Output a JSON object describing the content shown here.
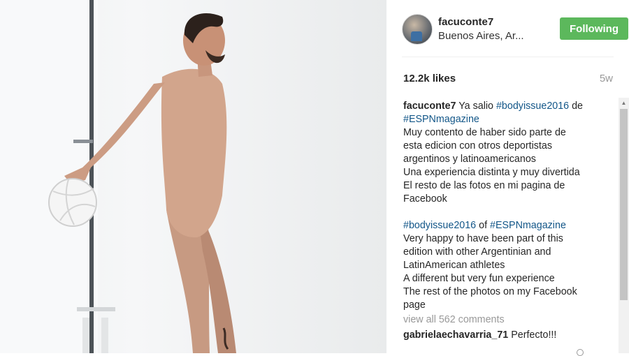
{
  "post": {
    "image": {
      "icon": "photo"
    },
    "header": {
      "username": "facuconte7",
      "location": "Buenos Aires, Ar...",
      "follow_label": "Following",
      "avatar_icon": "avatar"
    },
    "likes": "12.2k likes",
    "age": "5w",
    "caption": {
      "username": "facuconte7",
      "lines": [
        [
          "Ya salio ",
          "#bodyissue2016",
          " de"
        ],
        [
          "#ESPNmagazine"
        ],
        [
          "Muy contento de haber sido parte de"
        ],
        [
          "esta edicion con otros deportistas"
        ],
        [
          "argentinos y latinoamericanos"
        ],
        [
          "Una experiencia distinta y muy divertida"
        ],
        [
          "El resto de las fotos en mi pagina de"
        ],
        [
          "Facebook"
        ],
        [
          "#bodyissue2016",
          " of ",
          "#ESPNmagazine"
        ],
        [
          "Very happy to have been part of this"
        ],
        [
          "edition with other Argentinian and"
        ],
        [
          "LatinAmerican athletes"
        ],
        [
          "A different but very fun experience"
        ],
        [
          "The rest of the photos on my Facebook"
        ],
        [
          "page"
        ]
      ]
    },
    "view_all_comments": "view all 562 comments",
    "comments": [
      {
        "username": "gabrielaechavarria_71",
        "text": " Perfecto!!!"
      }
    ]
  },
  "colors": {
    "follow_button": "#5cb85c",
    "hashtag": "#125688",
    "muted": "#999999"
  }
}
